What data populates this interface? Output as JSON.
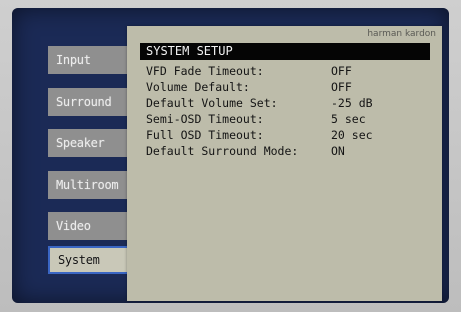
{
  "sidebar": {
    "items": [
      {
        "label": "Input"
      },
      {
        "label": "Surround"
      },
      {
        "label": "Speaker"
      },
      {
        "label": "Multiroom"
      },
      {
        "label": "Video"
      },
      {
        "label": "System",
        "selected": true
      }
    ]
  },
  "panel": {
    "brand": "harman kardon",
    "title": "SYSTEM SETUP",
    "settings": [
      {
        "label": "VFD Fade Timeout:",
        "value": "OFF"
      },
      {
        "label": "Volume Default:",
        "value": "OFF"
      },
      {
        "label": "Default Volume Set:",
        "value": "-25 dB"
      },
      {
        "label": "Semi-OSD Timeout:",
        "value": "5 sec"
      },
      {
        "label": "Full OSD Timeout:",
        "value": "20 sec"
      },
      {
        "label": "Default Surround Mode:",
        "value": "ON"
      }
    ]
  },
  "colors": {
    "screen_bg": "#1b2a56",
    "panel_bg": "#bdbcaa",
    "menu_item_bg": "#8f8f8f",
    "selected_border": "#3a66c4",
    "title_bar_bg": "#050505"
  }
}
